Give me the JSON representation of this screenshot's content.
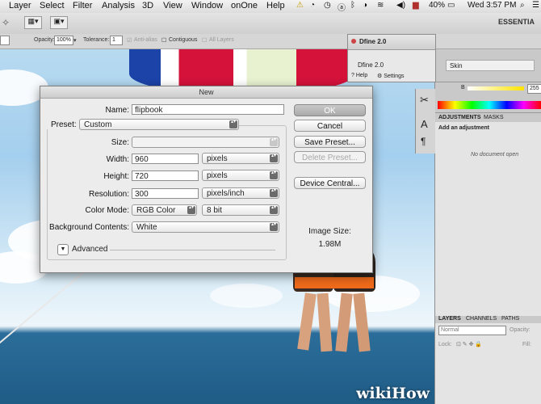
{
  "menubar": {
    "items": [
      "Layer",
      "Select",
      "Filter",
      "Analysis",
      "3D",
      "View",
      "Window",
      "onOne",
      "Help"
    ],
    "battery": "40%",
    "clock": "Wed 3:57 PM"
  },
  "options_bar": {
    "opacity_label": "Opacity:",
    "opacity_value": "100%",
    "tolerance_label": "Tolerance:",
    "tolerance_value": "1",
    "anti_alias": "Anti-alias",
    "contiguous": "Contiguous",
    "all_layers": "All Layers",
    "workspace": "ESSENTIA"
  },
  "dfine": {
    "title": "Dfine 2.0",
    "field": "Dfine 2.0",
    "col": "Skin",
    "help": "Help",
    "settings": "Settings"
  },
  "panels": {
    "value_255": "255",
    "value_b": "B",
    "tabs_adj": [
      "ADJUSTMENTS",
      "MASKS"
    ],
    "add_adjustment": "Add an adjustment",
    "no_document": "No document open",
    "tabs_layers": [
      "LAYERS",
      "CHANNELS",
      "PATHS"
    ],
    "blend_mode": "Normal",
    "opacity_label": "Opacity:",
    "lock_label": "Lock:",
    "fill_label": "Fill:"
  },
  "dialog": {
    "title": "New",
    "name_label": "Name:",
    "name_value": "flipbook",
    "preset_label": "Preset:",
    "preset_value": "Custom",
    "size_label": "Size:",
    "width_label": "Width:",
    "width_value": "960",
    "width_unit": "pixels",
    "height_label": "Height:",
    "height_value": "720",
    "height_unit": "pixels",
    "resolution_label": "Resolution:",
    "resolution_value": "300",
    "resolution_unit": "pixels/inch",
    "color_mode_label": "Color Mode:",
    "color_mode_value": "RGB Color",
    "bit_depth": "8 bit",
    "bg_label": "Background Contents:",
    "bg_value": "White",
    "advanced": "Advanced",
    "ok": "OK",
    "cancel": "Cancel",
    "save_preset": "Save Preset...",
    "delete_preset": "Delete Preset...",
    "device_central": "Device Central...",
    "image_size_label": "Image Size:",
    "image_size_value": "1.98M"
  },
  "watermark": "wikiHow",
  "colors": {
    "dialog_bg": "#ececec",
    "default_button": "#b5b5b5",
    "sky": "#a4cfee",
    "sea": "#1f5c86"
  }
}
